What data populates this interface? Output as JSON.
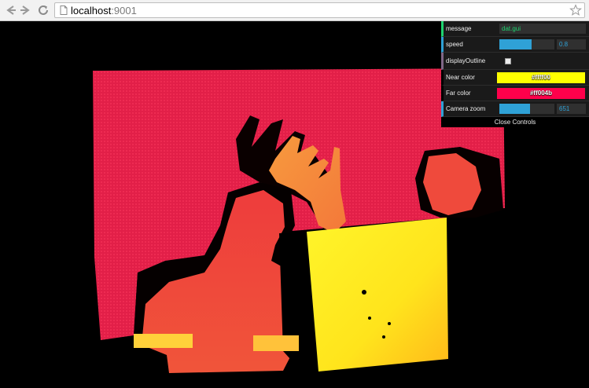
{
  "browser": {
    "url_host": "localhost",
    "url_port": ":9001"
  },
  "gui": {
    "message": {
      "label": "message",
      "value": "dat.gui"
    },
    "speed": {
      "label": "speed",
      "value": "0.8",
      "fill": 0.58
    },
    "display_outline": {
      "label": "displayOutline",
      "checked": false
    },
    "near_color": {
      "label": "Near color",
      "value": "#ffff00"
    },
    "far_color": {
      "label": "Far color",
      "value": "#ff004b"
    },
    "camera_zoom": {
      "label": "Camera zoom",
      "value": "651",
      "fill": 0.56
    },
    "close_label": "Close Controls"
  },
  "colors": {
    "background": "#000000",
    "wall": "#e8204a",
    "person": "#ec3d3d",
    "hand": "#f58a3a",
    "board": "#ffe91c",
    "string_accent": "#1ed36f",
    "number_accent": "#2fa1d6"
  }
}
